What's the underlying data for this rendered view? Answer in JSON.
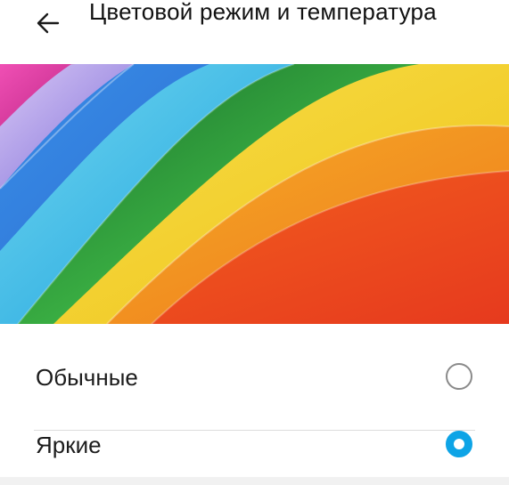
{
  "header": {
    "title": "Цветовой режим и температура",
    "back_icon": "arrow-left-icon"
  },
  "hero": {
    "description_colors": [
      "#e23a9a",
      "#b79be8",
      "#2a9be6",
      "#49c6e8",
      "#2fa83a",
      "#f3d21a",
      "#f08a1c",
      "#e8442a",
      "#d61f1f"
    ]
  },
  "options": [
    {
      "label": "Обычные",
      "selected": false
    },
    {
      "label": "Яркие",
      "selected": true
    }
  ],
  "colors": {
    "accent": "#0ea4e6",
    "radio_off": "#8a8a8a",
    "divider": "#dcdcdc"
  }
}
